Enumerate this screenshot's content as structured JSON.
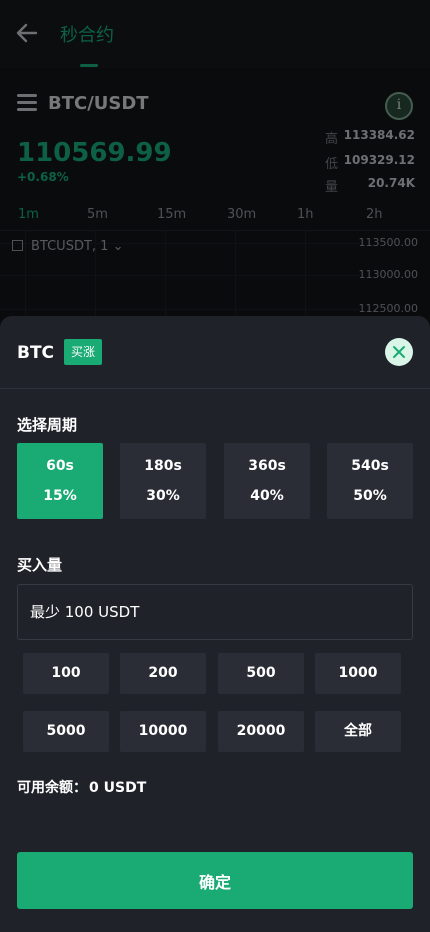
{
  "header": {
    "title": "秒合约"
  },
  "market": {
    "pair": "BTC/USDT",
    "price": "110569.99",
    "change": "+0.68%",
    "stats": [
      {
        "label": "高",
        "value": "113384.62"
      },
      {
        "label": "低",
        "value": "109329.12"
      },
      {
        "label": "量",
        "value": "20.74K"
      }
    ],
    "intervals": [
      "1m",
      "5m",
      "15m",
      "30m",
      "1h",
      "2h"
    ],
    "chart_symbol": "BTCUSDT, 1",
    "axis_labels": [
      "113500.00",
      "113000.00",
      "112500.00"
    ]
  },
  "order": {
    "symbol": "BTC",
    "direction": "买涨",
    "period_label": "选择周期",
    "periods": [
      {
        "time": "60s",
        "rate": "15%"
      },
      {
        "time": "180s",
        "rate": "30%"
      },
      {
        "time": "360s",
        "rate": "40%"
      },
      {
        "time": "540s",
        "rate": "50%"
      }
    ],
    "amount_label": "买入量",
    "amount_placeholder": "最少 100 USDT",
    "amounts": [
      "100",
      "200",
      "500",
      "1000",
      "5000",
      "10000",
      "20000",
      "全部"
    ],
    "balance_label": "可用余额：",
    "balance_value": "0 USDT",
    "confirm_label": "确定"
  },
  "colors": {
    "accent": "#1aaa74",
    "sheet": "#1f2229",
    "chip": "#2a2d35"
  }
}
